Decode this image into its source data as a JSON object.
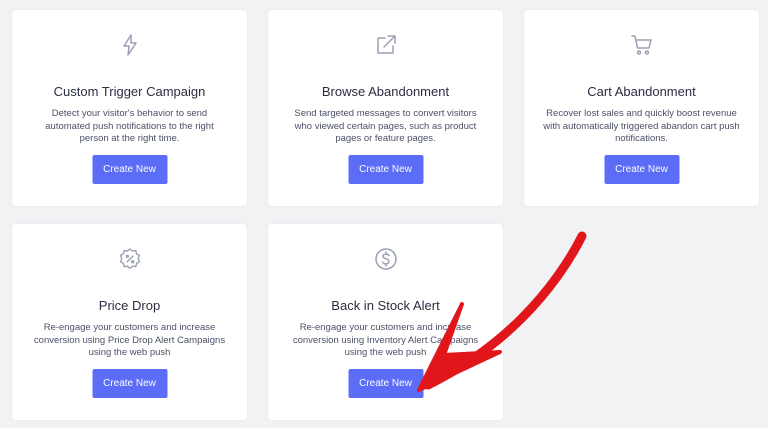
{
  "cards": [
    {
      "icon": "lightning-icon",
      "title": "Custom Trigger Campaign",
      "description": "Detect your visitor's behavior to send automated push notifications to the right person at the right time.",
      "button": "Create New"
    },
    {
      "icon": "external-link-icon",
      "title": "Browse Abandonment",
      "description": "Send targeted messages to convert visitors who viewed certain pages, such as product pages or feature pages.",
      "button": "Create New"
    },
    {
      "icon": "shopping-cart-icon",
      "title": "Cart Abandonment",
      "description": "Recover lost sales and quickly boost revenue with automatically triggered abandon cart push notifications.",
      "button": "Create New"
    },
    {
      "icon": "discount-badge-icon",
      "title": "Price Drop",
      "description": "Re-engage your customers and increase conversion using Price Drop Alert Campaigns using the web push",
      "button": "Create New"
    },
    {
      "icon": "dollar-circle-icon",
      "title": "Back in Stock Alert",
      "description": "Re-engage your customers and increase conversion using Inventory Alert Campaigns using the web push",
      "button": "Create New"
    }
  ],
  "colors": {
    "background": "#f2f2f5",
    "card": "#ffffff",
    "button": "#5b6cf6",
    "icon": "#9aa0b4",
    "annotation_arrow": "#e0161b"
  }
}
